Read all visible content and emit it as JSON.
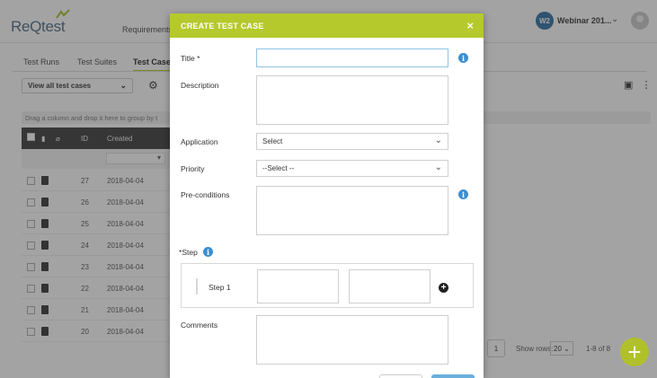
{
  "app": {
    "logo": "ReQtest",
    "nav_requirements": "Requirements",
    "user_initials": "W2",
    "user_name": "Webinar 201...",
    "tabs": [
      {
        "label": "Test Runs"
      },
      {
        "label": "Test Suites"
      },
      {
        "label": "Test Case"
      }
    ],
    "view_select": "View all test cases",
    "group_hint": "Drag a column and drop it here to group by t",
    "columns": {
      "id": "ID",
      "created": "Created"
    },
    "rows": [
      {
        "id": "27",
        "created": "2018-04-04"
      },
      {
        "id": "26",
        "created": "2018-04-04"
      },
      {
        "id": "25",
        "created": "2018-04-04"
      },
      {
        "id": "24",
        "created": "2018-04-04"
      },
      {
        "id": "23",
        "created": "2018-04-04"
      },
      {
        "id": "22",
        "created": "2018-04-04"
      },
      {
        "id": "21",
        "created": "2018-04-04"
      },
      {
        "id": "20",
        "created": "2018-04-04"
      }
    ],
    "pager": {
      "page": "1",
      "show_rows_label": "Show rows:",
      "rows_value": "20",
      "count": "1-8 of 8"
    },
    "fab": "+"
  },
  "modal": {
    "title": "CREATE TEST CASE",
    "close": "×",
    "title_label": "Title",
    "title_required": "*",
    "description_label": "Description",
    "application_label": "Application",
    "application_value": "Select",
    "priority_label": "Priority",
    "priority_value": "--Select --",
    "preconditions_label": "Pre-conditions",
    "step_required": "*",
    "step_label": "Step",
    "step1_label": "Step 1",
    "comments_label": "Comments",
    "info": "i",
    "add_step": "+"
  },
  "colors": {
    "accent": "#b5c92c",
    "info": "#3b8fd1",
    "header_dark": "#3a3a3a"
  },
  "icons": [
    "logo-mark-icon",
    "chevron-down-icon",
    "gear-icon",
    "document-icon",
    "more-icon",
    "info-icon",
    "close-icon",
    "add-step-icon",
    "plus-icon"
  ]
}
